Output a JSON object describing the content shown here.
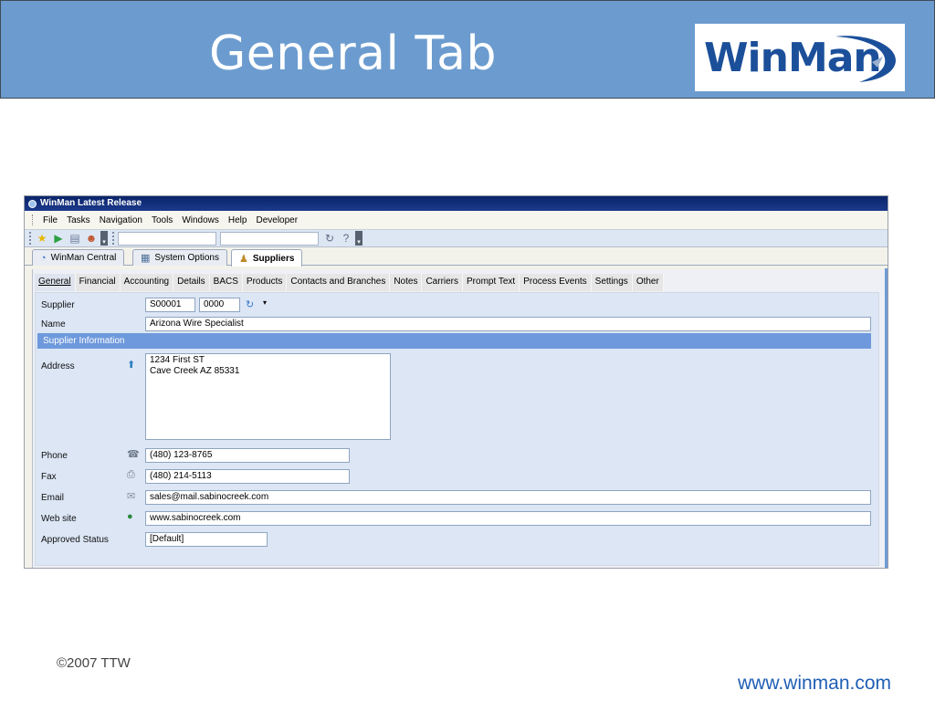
{
  "slide": {
    "title": "General Tab",
    "logo_text": "WinMan",
    "copyright": "©2007 TTW",
    "url": "www.winman.com"
  },
  "app": {
    "title": "WinMan Latest Release",
    "menu": [
      "File",
      "Tasks",
      "Navigation",
      "Tools",
      "Windows",
      "Help",
      "Developer"
    ],
    "menu_underline": [
      "F",
      "T",
      "N",
      "o",
      "W",
      "H",
      ""
    ],
    "doc_tabs": [
      "WinMan Central",
      "System Options",
      "Suppliers"
    ],
    "active_doc_tab": "Suppliers",
    "form_tabs": [
      "General",
      "Financial",
      "Accounting",
      "Details",
      "BACS",
      "Products",
      "Contacts and Branches",
      "Notes",
      "Carriers",
      "Prompt Text",
      "Process Events",
      "Settings",
      "Other"
    ],
    "active_form_tab": "General"
  },
  "form": {
    "supplier_label": "Supplier",
    "supplier_code": "S00001",
    "supplier_branch": "0000",
    "name_label": "Name",
    "name_value": "Arizona Wire Specialist",
    "section_title": "Supplier Information",
    "address_label": "Address",
    "address_value": "1234 First ST\nCave Creek AZ 85331",
    "phone_label": "Phone",
    "phone_value": "(480) 123-8765",
    "fax_label": "Fax",
    "fax_value": "(480) 214-5113",
    "email_label": "Email",
    "email_value": "sales@mail.sabinocreek.com",
    "website_label": "Web site",
    "website_value": "www.sabinocreek.com",
    "approved_label": "Approved Status",
    "approved_value": "[Default]"
  },
  "colors": {
    "header_bg": "#6c9ccf",
    "titlebar": "#0a246a",
    "section_bar": "#6e99dc",
    "form_panel": "#dce6f5",
    "url": "#1f5fb4"
  }
}
